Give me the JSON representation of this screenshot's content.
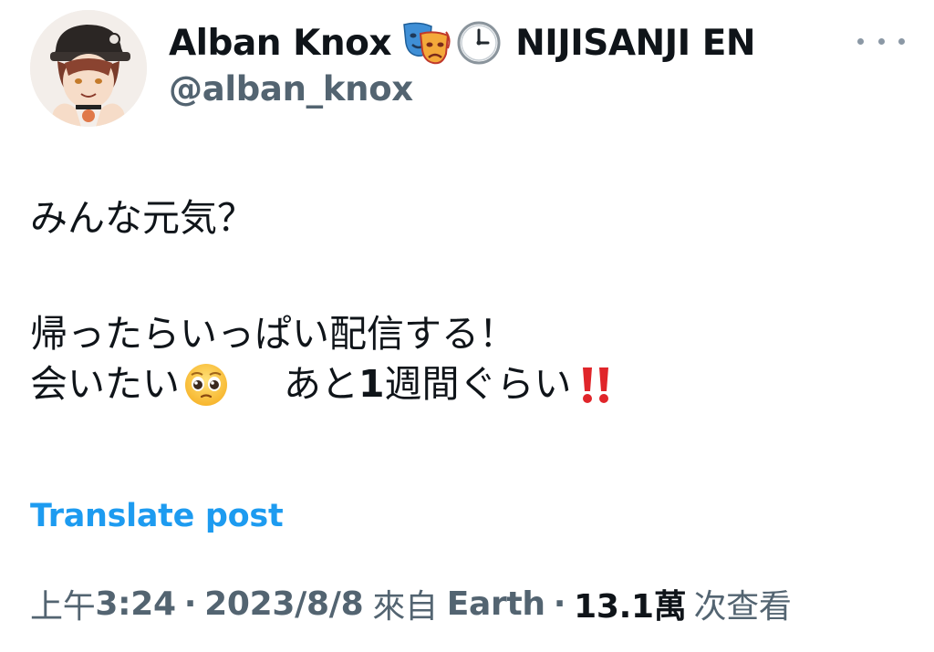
{
  "author": {
    "display_name": "Alban Knox",
    "badge_icons": [
      "performing-arts-icon",
      "clock-icon"
    ],
    "affiliation": "NIJISANJI EN",
    "handle": "@alban_knox"
  },
  "tweet": {
    "line1": "みんな元気？",
    "line2": "帰ったらいっぱい配信する！",
    "line3_part1": "会いたい",
    "line3_emoji": "pleading-face-icon",
    "line3_part2a": "あと",
    "line3_number": "1",
    "line3_part2b": "週間ぐらい",
    "line3_end_emoji": "double-exclamation-icon"
  },
  "translate_label": "Translate post",
  "meta": {
    "time_prefix": "上午",
    "time": "3:24",
    "separator": "·",
    "date": "2023/8/8",
    "source_prefix": "來自",
    "source": "Earth",
    "views_count": "13.1萬",
    "views_label": "次查看"
  },
  "colors": {
    "text": "#0f1419",
    "secondary": "#536471",
    "link": "#1d9bf0"
  }
}
